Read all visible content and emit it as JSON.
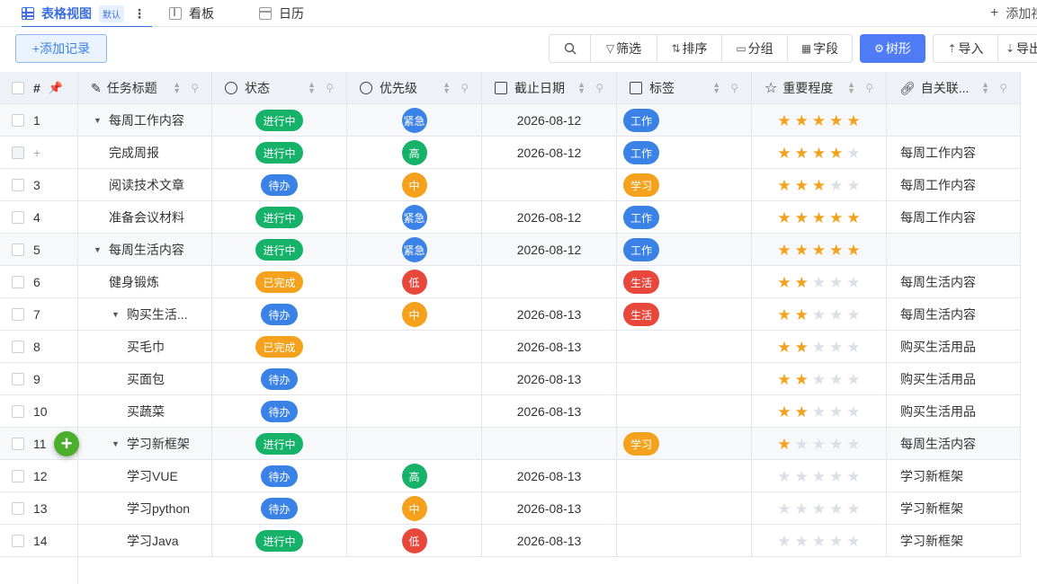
{
  "tabs": [
    {
      "label": "表格视图",
      "badge": "默认",
      "icon": "grid-icon",
      "active": true
    },
    {
      "label": "看板",
      "icon": "board-icon",
      "active": false
    },
    {
      "label": "日历",
      "icon": "calendar-icon",
      "active": false
    }
  ],
  "add_view": "添加视图",
  "toolbar": {
    "add_record": "+添加记录",
    "search_icon": "search-icon",
    "filter": "筛选",
    "sort": "排序",
    "group": "分组",
    "fields": "字段",
    "tree": "树形",
    "import": "导入",
    "export": "导出"
  },
  "columns": {
    "index": "#",
    "title": "任务标题",
    "status": "状态",
    "priority": "优先级",
    "due": "截止日期",
    "tag": "标签",
    "importance": "重要程度",
    "related": "自关联..."
  },
  "colors": {
    "status": {
      "进行中": "#17b26a",
      "待办": "#3b82e6",
      "已完成": "#f4a11d"
    },
    "priority": {
      "紧急": "#3b82e6",
      "高": "#17b26a",
      "中": "#f4a11d",
      "低": "#e8473c"
    },
    "tag": {
      "工作": "#3b82e6",
      "学习": "#f4a11d",
      "生活": "#e8473c"
    }
  },
  "rows": [
    {
      "num": "1",
      "title": "每周工作内容",
      "level": 0,
      "caret": true,
      "status": "进行中",
      "priority": "紧急",
      "due": "2026-08-12",
      "tag": "工作",
      "stars": 5,
      "related": ""
    },
    {
      "num": "+",
      "title": "完成周报",
      "level": 1,
      "caret": false,
      "status": "进行中",
      "priority": "高",
      "due": "2026-08-12",
      "tag": "工作",
      "stars": 4,
      "related": "每周工作内容"
    },
    {
      "num": "3",
      "title": "阅读技术文章",
      "level": 1,
      "caret": false,
      "status": "待办",
      "priority": "中",
      "due": "",
      "tag": "学习",
      "stars": 3,
      "related": "每周工作内容"
    },
    {
      "num": "4",
      "title": "准备会议材料",
      "level": 1,
      "caret": false,
      "status": "进行中",
      "priority": "紧急",
      "due": "2026-08-12",
      "tag": "工作",
      "stars": 5,
      "related": "每周工作内容"
    },
    {
      "num": "5",
      "title": "每周生活内容",
      "level": 0,
      "caret": true,
      "status": "进行中",
      "priority": "紧急",
      "due": "2026-08-12",
      "tag": "工作",
      "stars": 5,
      "related": ""
    },
    {
      "num": "6",
      "title": "健身锻炼",
      "level": 1,
      "caret": false,
      "status": "已完成",
      "priority": "低",
      "due": "",
      "tag": "生活",
      "stars": 2,
      "related": "每周生活内容"
    },
    {
      "num": "7",
      "title": "购买生活...",
      "level": 1,
      "caret": true,
      "status": "待办",
      "priority": "中",
      "due": "2026-08-13",
      "tag": "生活",
      "stars": 2,
      "related": "每周生活内容"
    },
    {
      "num": "8",
      "title": "买毛巾",
      "level": 2,
      "caret": false,
      "status": "已完成",
      "priority": "",
      "due": "2026-08-13",
      "tag": "",
      "stars": 2,
      "related": "购买生活用品"
    },
    {
      "num": "9",
      "title": "买面包",
      "level": 2,
      "caret": false,
      "status": "待办",
      "priority": "",
      "due": "2026-08-13",
      "tag": "",
      "stars": 2,
      "related": "购买生活用品"
    },
    {
      "num": "10",
      "title": "买蔬菜",
      "level": 2,
      "caret": false,
      "status": "待办",
      "priority": "",
      "due": "2026-08-13",
      "tag": "",
      "stars": 2,
      "related": "购买生活用品"
    },
    {
      "num": "11",
      "title": "学习新框架",
      "level": 1,
      "caret": true,
      "status": "进行中",
      "priority": "",
      "due": "",
      "tag": "学习",
      "stars": 1,
      "related": "每周生活内容"
    },
    {
      "num": "12",
      "title": "学习VUE",
      "level": 2,
      "caret": false,
      "status": "待办",
      "priority": "高",
      "due": "2026-08-13",
      "tag": "",
      "stars": 0,
      "related": "学习新框架"
    },
    {
      "num": "13",
      "title": "学习python",
      "level": 2,
      "caret": false,
      "status": "待办",
      "priority": "中",
      "due": "2026-08-13",
      "tag": "",
      "stars": 0,
      "related": "学习新框架"
    },
    {
      "num": "14",
      "title": "学习Java",
      "level": 2,
      "caret": false,
      "status": "进行中",
      "priority": "低",
      "due": "2026-08-13",
      "tag": "",
      "stars": 0,
      "related": "学习新框架"
    }
  ],
  "fab": "+"
}
